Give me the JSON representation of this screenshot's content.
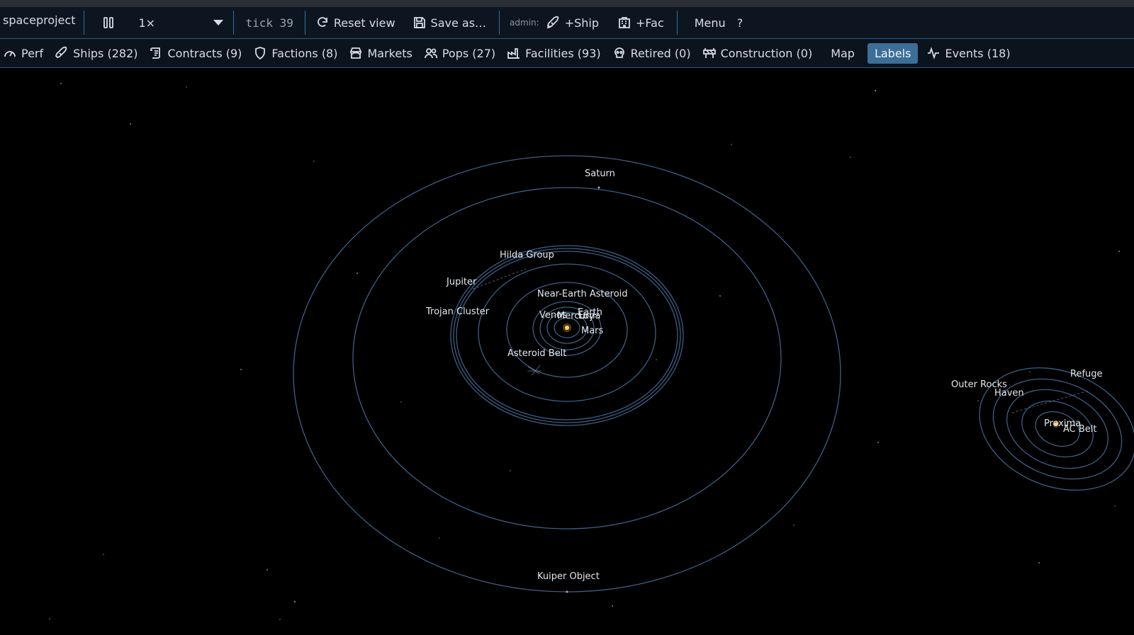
{
  "toolbar": {
    "app_name": "spaceproject",
    "speed": "1×",
    "tick": "tick 39",
    "reset_view": "Reset view",
    "save_as": "Save as…",
    "admin_label": "admin:",
    "add_ship": "+Ship",
    "add_fac": "+Fac",
    "menu": "Menu",
    "help": "?"
  },
  "nav": {
    "perf": "Perf",
    "ships": "Ships (282)",
    "contracts": "Contracts (9)",
    "factions": "Factions (8)",
    "markets": "Markets",
    "pops": "Pops (27)",
    "facilities": "Facilities (93)",
    "retired": "Retired (0)",
    "construction": "Construction (0)",
    "map": "Map",
    "labels": "Labels",
    "events": "Events (18)"
  },
  "map_labels": {
    "saturn": "Saturn",
    "hilda": "Hilda Group",
    "jupiter": "Jupiter",
    "near_earth": "Near-Earth Asteroid",
    "trojan": "Trojan Cluster",
    "venus": "Venus",
    "mercury": "Mercury",
    "earth": "Earth",
    "luna": "Luna",
    "mars": "Mars",
    "asteroid_belt": "Asteroid Belt",
    "kuiper": "Kuiper Object",
    "outer_rocks": "Outer Rocks",
    "haven": "Haven",
    "refuge": "Refuge",
    "proxima": "Proxima",
    "ac_belt": "AC Belt"
  },
  "colors": {
    "orbit": "#3d5f86",
    "accent": "#3c6e98",
    "star": "#f0b040"
  }
}
